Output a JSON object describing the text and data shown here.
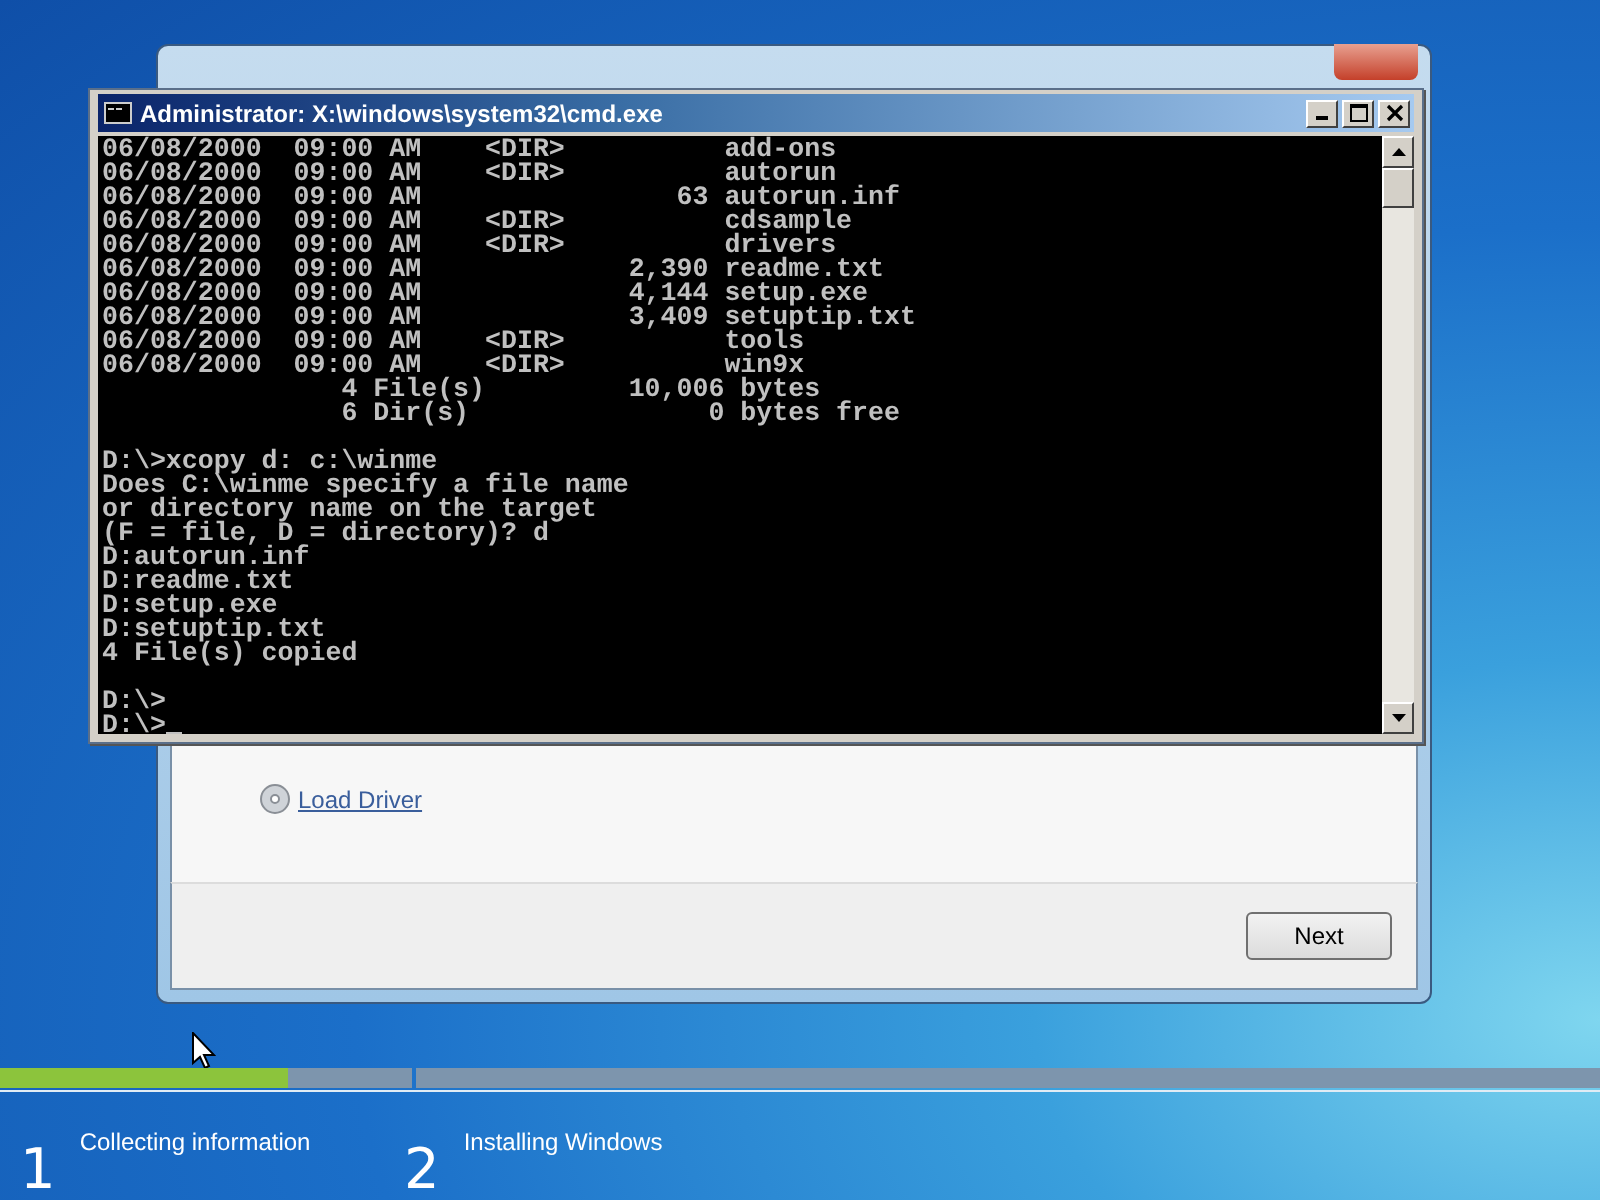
{
  "setup_window": {
    "link": "Load Driver",
    "buttons": [
      "Next"
    ]
  },
  "console_window": {
    "title": "Administrator: X:\\windows\\system32\\cmd.exe",
    "cursor": true,
    "blocks": [
      [
        "06/08/2000  09:00 AM    <DIR>          add-ons",
        "06/08/2000  09:00 AM    <DIR>          autorun",
        "06/08/2000  09:00 AM                63 autorun.inf",
        "06/08/2000  09:00 AM    <DIR>          cdsample",
        "06/08/2000  09:00 AM    <DIR>          drivers",
        "06/08/2000  09:00 AM             2,390 readme.txt",
        "06/08/2000  09:00 AM             4,144 setup.exe",
        "06/08/2000  09:00 AM             3,409 setuptip.txt",
        "06/08/2000  09:00 AM    <DIR>          tools",
        "06/08/2000  09:00 AM    <DIR>          win9x",
        "               4 File(s)         10,006 bytes",
        "               6 Dir(s)               0 bytes free"
      ],
      [
        "D:\\>xcopy d: c:\\winme",
        "Does C:\\winme specify a file name",
        "or directory name on the target",
        "(F = file, D = directory)? d",
        "D:autorun.inf",
        "D:readme.txt",
        "D:setup.exe",
        "D:setuptip.txt",
        "4 File(s) copied"
      ],
      [
        "D:\\>",
        "D:\\>"
      ]
    ]
  },
  "progress": {
    "steps": [
      {
        "number": "1",
        "label": "Collecting information",
        "level": 0.7
      },
      {
        "number": "2",
        "label": "Installing Windows",
        "level": 0
      }
    ]
  }
}
